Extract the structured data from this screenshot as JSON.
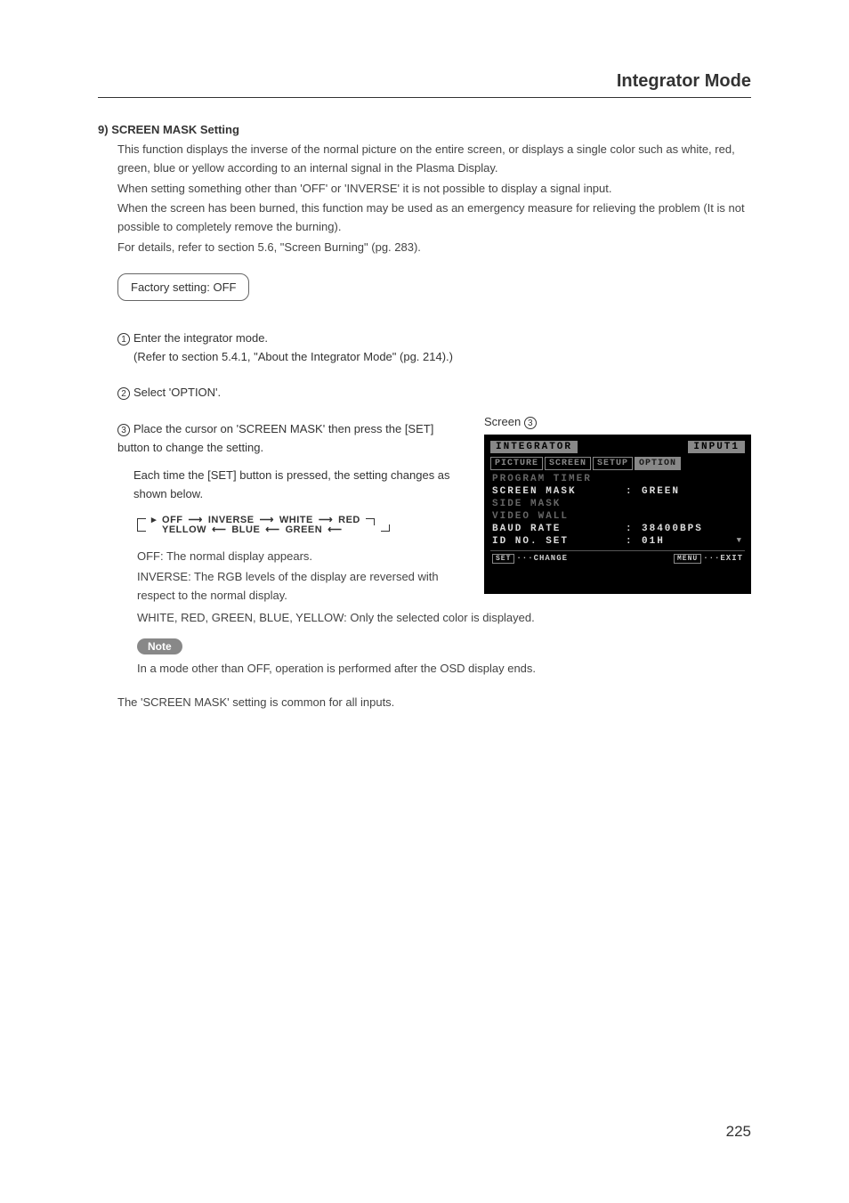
{
  "header": "Integrator Mode",
  "section": {
    "number": "9)",
    "title": "SCREEN MASK Setting"
  },
  "intro": [
    "This function displays the inverse of the normal picture on the entire screen, or displays a single color such as white, red, green, blue or yellow according to an internal signal in the Plasma Display.",
    "When setting something other than 'OFF' or 'INVERSE' it is not possible to display a signal input.",
    "When the screen has been burned, this function may be used as an emergency measure for relieving the problem (It is not possible to completely remove the burning).",
    "For details, refer to section 5.6, \"Screen Burning\" (pg. 283)."
  ],
  "factory": "Factory setting: OFF",
  "steps": {
    "s1a": "Enter the integrator mode.",
    "s1b": "(Refer to section 5.4.1, \"About the Integrator Mode\" (pg. 214).)",
    "s2": "Select 'OPTION'.",
    "s3a": "Place the cursor on 'SCREEN MASK' then press the [SET] button to change the setting.",
    "s3b": "Each time the [SET] button is pressed, the setting changes as shown below."
  },
  "cycle": {
    "top": [
      "OFF",
      "INVERSE",
      "WHITE",
      "RED"
    ],
    "bottom": [
      "YELLOW",
      "BLUE",
      "GREEN"
    ]
  },
  "explain": {
    "off": "OFF: The normal display appears.",
    "inverse": "INVERSE: The RGB levels of the display are reversed with respect to the normal display.",
    "colors": "WHITE, RED, GREEN, BLUE, YELLOW:  Only the selected color is displayed."
  },
  "note_label": "Note",
  "note_text": "In a mode other than OFF, operation is performed after the OSD display ends.",
  "footnote": "The 'SCREEN MASK' setting is common for all inputs.",
  "screen_label": "Screen ",
  "osd": {
    "title_left": "INTEGRATOR",
    "title_right": "INPUT1",
    "tabs": [
      "PICTURE",
      "SCREEN",
      "SETUP",
      "OPTION"
    ],
    "rows": [
      {
        "label": "PROGRAM TIMER",
        "value": "",
        "hl": false,
        "colon": false
      },
      {
        "label": "SCREEN MASK",
        "value": "GREEN",
        "hl": true,
        "colon": true
      },
      {
        "label": "SIDE MASK",
        "value": "",
        "hl": false,
        "colon": false
      },
      {
        "label": "VIDEO WALL",
        "value": "",
        "hl": false,
        "colon": false
      },
      {
        "label": "BAUD RATE",
        "value": "38400BPS",
        "hl": true,
        "colon": true
      },
      {
        "label": "ID NO. SET",
        "value": "01H",
        "hl": true,
        "colon": true,
        "arrow": true
      }
    ],
    "footer_left_key": "SET",
    "footer_left": "···CHANGE",
    "footer_right_key": "MENU",
    "footer_right": "···EXIT"
  },
  "page_number": "225"
}
